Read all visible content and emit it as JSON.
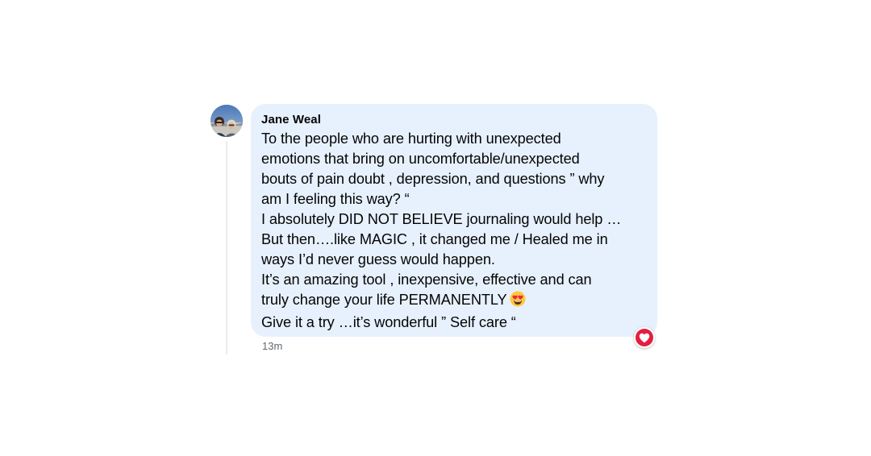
{
  "comment": {
    "author": "Jane Weal",
    "lines": [
      "To the people who are hurting with unexpected",
      "emotions that bring on uncomfortable/unexpected",
      "bouts of pain doubt , depression, and questions ” why",
      "am I feeling this way? “",
      "I absolutely DID NOT BELIEVE journaling would help …",
      "But then….like MAGIC , it changed me / Healed me in",
      "ways I’d never guess would happen.",
      "It’s an amazing tool , inexpensive, effective and can",
      "truly change your life PERMANENTLY",
      "Give it a try …it’s wonderful ” Self care “"
    ],
    "inline_emoji": "heart-eyes-emoji",
    "reaction": "love-reaction-icon",
    "timestamp": "13m"
  },
  "colors": {
    "bubble": "#e7f1fd",
    "text": "#050505",
    "timestamp": "#65676b",
    "reaction_red": "#e41e3f",
    "thread_line": "#ebedf0"
  }
}
